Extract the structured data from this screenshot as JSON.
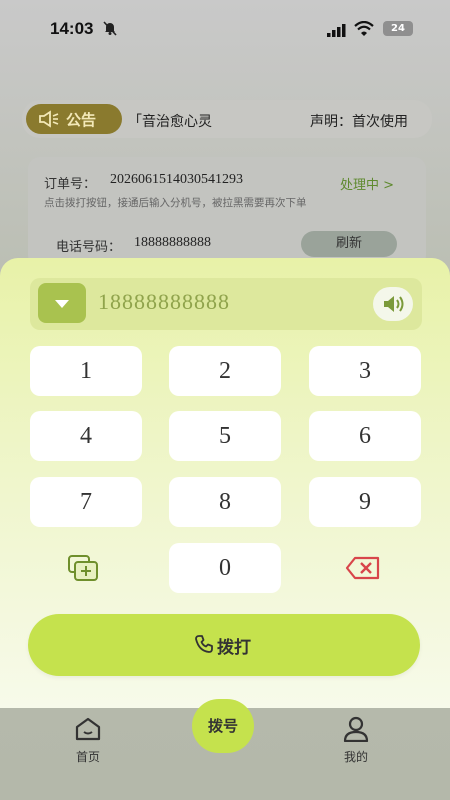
{
  "status_bar": {
    "time": "14:03",
    "battery": "24"
  },
  "notice": {
    "badge": "公告",
    "text": "「音治愈心灵",
    "right_text": "声明：首次使用"
  },
  "order": {
    "label": "订单号：",
    "number": "2026061514030541293",
    "status": "处理中 >",
    "hint": "点击拨打按钮，接通后输入分机号，被拉黑需要再次下单",
    "phone_label": "电话号码：",
    "phone": "18888888888",
    "refresh": "刷新"
  },
  "dialer": {
    "number": "18888888888",
    "keys": [
      "1",
      "2",
      "3",
      "4",
      "5",
      "6",
      "7",
      "8",
      "9",
      "0"
    ],
    "call_label": "拨打",
    "accent": "#c5e24d"
  },
  "tabs": {
    "home": "首页",
    "dial": "拨号",
    "mine": "我的"
  }
}
